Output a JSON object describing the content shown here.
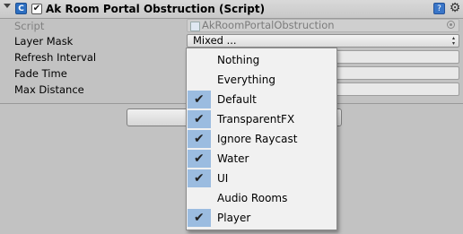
{
  "component": {
    "title": "Ak Room Portal Obstruction (Script)",
    "enabled": true
  },
  "fields": {
    "script": {
      "label": "Script",
      "value": "AkRoomPortalObstruction"
    },
    "layer_mask": {
      "label": "Layer Mask",
      "value": "Mixed ..."
    },
    "refresh_interval": {
      "label": "Refresh Interval"
    },
    "fade_time": {
      "label": "Fade Time"
    },
    "max_distance": {
      "label": "Max Distance"
    }
  },
  "menu": {
    "check_glyph": "✔",
    "items": [
      {
        "label": "Nothing",
        "checked": false
      },
      {
        "label": "Everything",
        "checked": false
      },
      {
        "label": "Default",
        "checked": true
      },
      {
        "label": "TransparentFX",
        "checked": true
      },
      {
        "label": "Ignore Raycast",
        "checked": true
      },
      {
        "label": "Water",
        "checked": true
      },
      {
        "label": "UI",
        "checked": true
      },
      {
        "label": "Audio Rooms",
        "checked": false
      },
      {
        "label": "Player",
        "checked": true
      }
    ]
  },
  "colors": {
    "background": "#c2c2c2",
    "check_highlight": "#9bbce0",
    "menu_bg": "#f1f1f1"
  }
}
